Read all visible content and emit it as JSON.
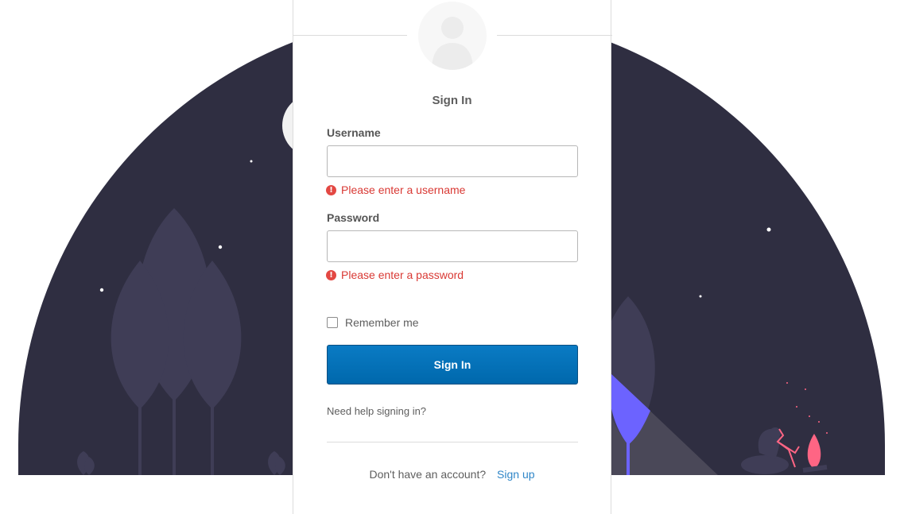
{
  "colors": {
    "scene_dark": "#2f2e41",
    "tree": "#3f3d56",
    "accent_tree": "#6c63ff",
    "fire": "#ff6584",
    "button": "#0074be",
    "error": "#d93934",
    "link": "#2f86c8"
  },
  "icons": {
    "avatar": "user-silhouette-icon",
    "error": "exclamation-circle-icon"
  },
  "form": {
    "title": "Sign In",
    "username_label": "Username",
    "username_value": "",
    "username_error": "Please enter a username",
    "password_label": "Password",
    "password_value": "",
    "password_error": "Please enter a password",
    "remember_label": "Remember me",
    "remember_checked": false,
    "submit_label": "Sign In",
    "help_link": "Need help signing in?"
  },
  "footer": {
    "prompt": "Don't have an account?",
    "signup_link": "Sign up"
  }
}
